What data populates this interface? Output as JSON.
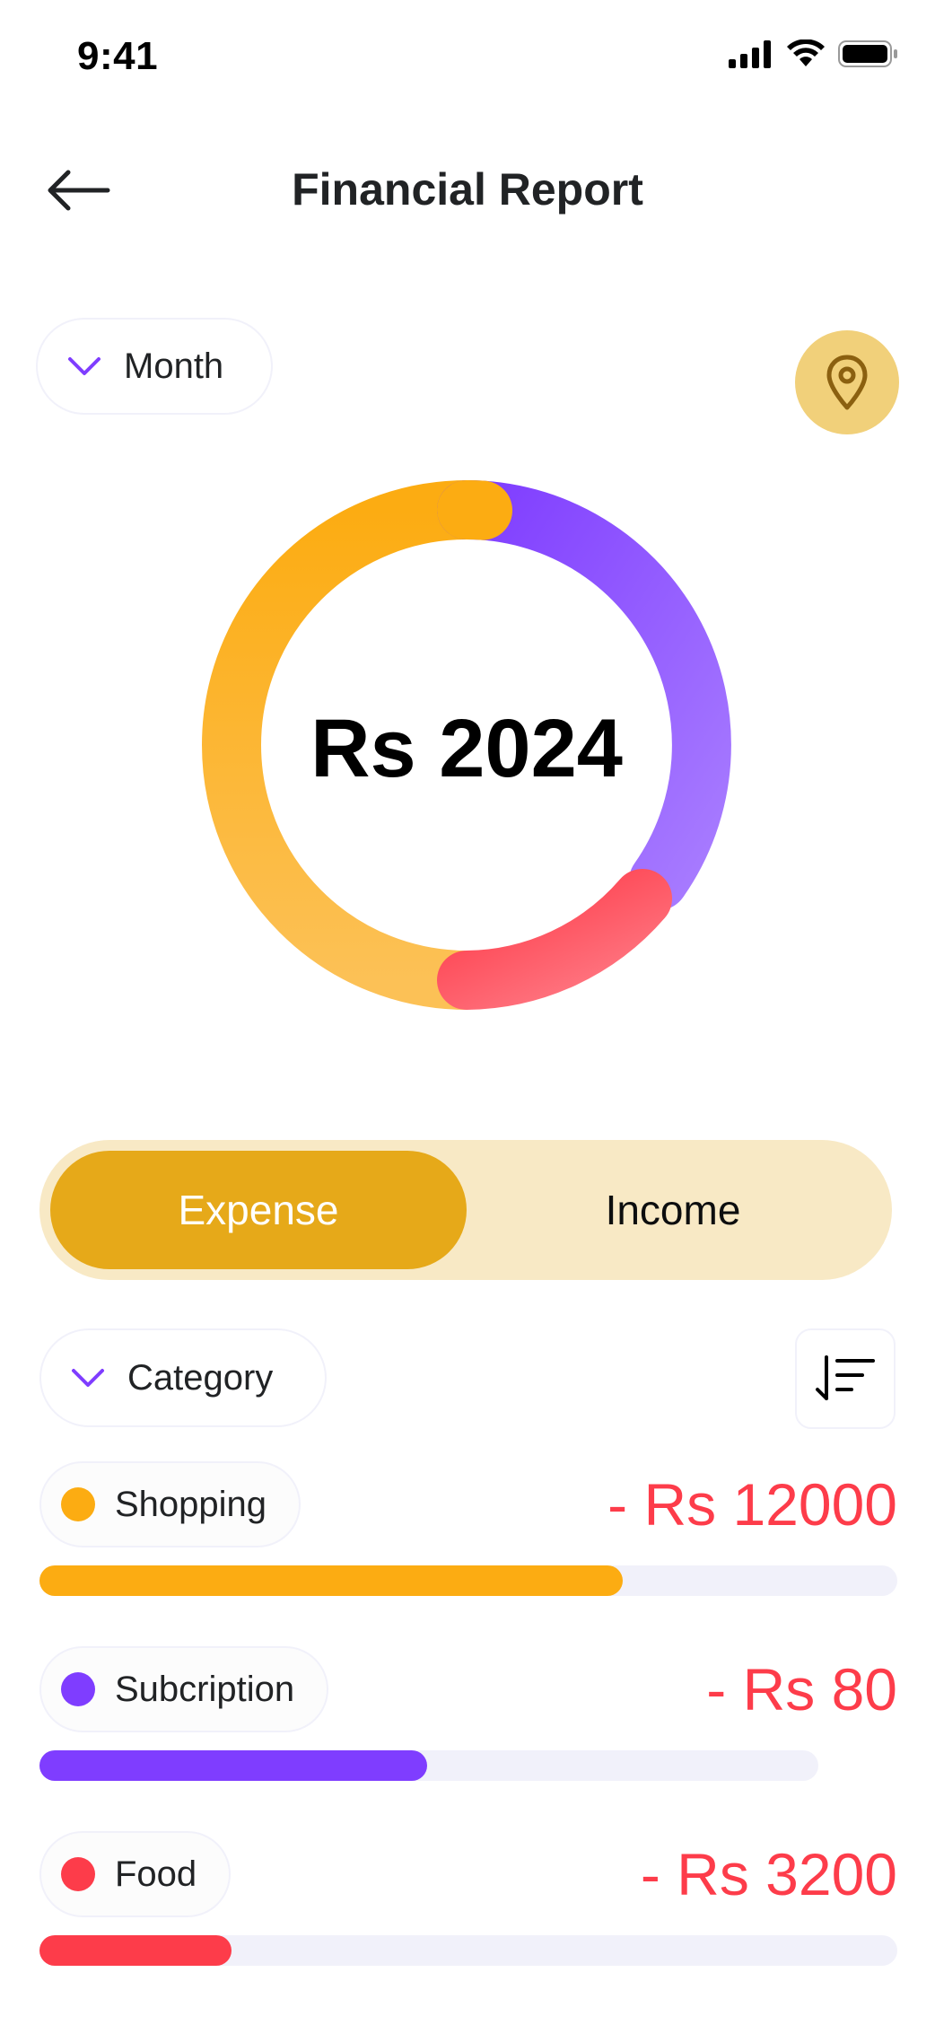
{
  "status_bar": {
    "time": "9:41"
  },
  "header": {
    "title": "Financial Report"
  },
  "filters": {
    "period_label": "Month"
  },
  "colors": {
    "shopping": "#FCAC12",
    "subscription": "#7F3DFF",
    "food": "#FD3C4A",
    "accent": "#E6A919",
    "amount": "#FD3C4A"
  },
  "donut": {
    "total": "Rs 2024"
  },
  "toggle": {
    "expense_label": "Expense",
    "income_label": "Income",
    "active": "Expense"
  },
  "list": {
    "category_label": "Category",
    "items": [
      {
        "name": "Shopping",
        "amount": "- Rs 12000",
        "color": "#FCAC12",
        "progress": 0.68
      },
      {
        "name": "Subcription",
        "amount": "- Rs 80",
        "color": "#7F3DFF",
        "progress": 0.5
      },
      {
        "name": "Food",
        "amount": "- Rs 3200",
        "color": "#FD3C4A",
        "progress": 0.22
      }
    ]
  }
}
